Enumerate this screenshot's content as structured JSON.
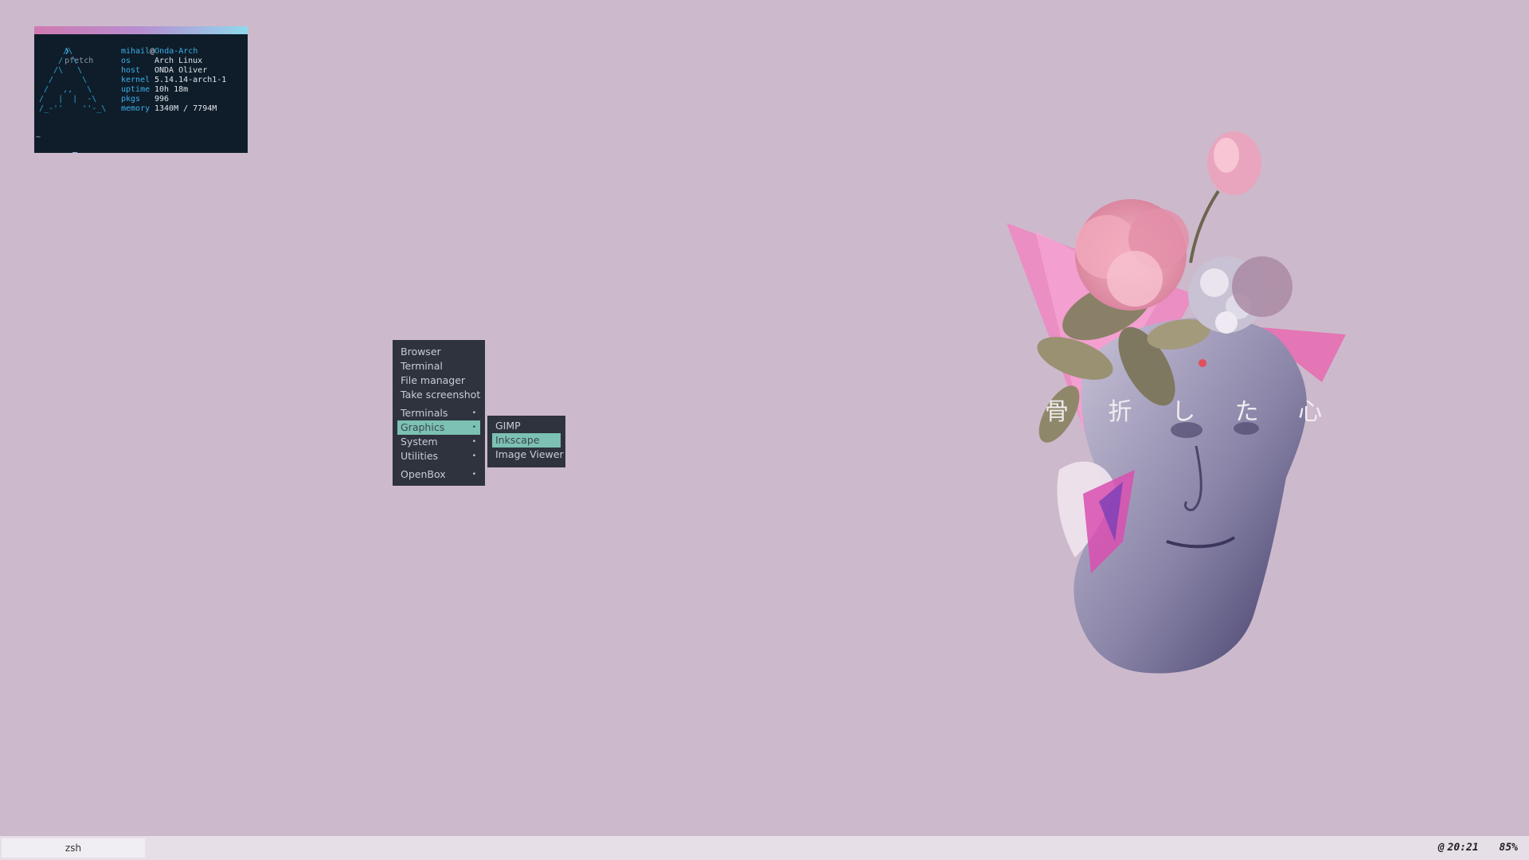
{
  "terminal": {
    "prompt_arrow": "❯",
    "command": "pfetch",
    "ascii_logo": "     /\\\n    /  \\\n   /\\   \\\n  /      \\\n /   ,,   \\\n/   |  |  -\\\n/_-''    ''-_\\",
    "user": "mihail",
    "at": "@",
    "host": "Onda-Arch",
    "info": [
      {
        "key": "os",
        "value": "Arch Linux"
      },
      {
        "key": "host",
        "value": "ONDA Oliver"
      },
      {
        "key": "kernel",
        "value": "5.14.14-arch1-1"
      },
      {
        "key": "uptime",
        "value": "10h 18m"
      },
      {
        "key": "pkgs",
        "value": "996"
      },
      {
        "key": "memory",
        "value": "1340M / 7794M"
      }
    ],
    "tilde": "~",
    "second_prompt": "❯"
  },
  "wallpaper": {
    "text": "骨 折 し た 心"
  },
  "menu": {
    "items": [
      {
        "label": "Browser",
        "submenu": false
      },
      {
        "label": "Terminal",
        "submenu": false
      },
      {
        "label": "File manager",
        "submenu": false
      },
      {
        "label": "Take screenshot",
        "submenu": false
      },
      {
        "label": "Terminals",
        "submenu": true
      },
      {
        "label": "Graphics",
        "submenu": true,
        "active": true
      },
      {
        "label": "System",
        "submenu": true
      },
      {
        "label": "Utilities",
        "submenu": true
      },
      {
        "label": "OpenBox",
        "submenu": true
      }
    ],
    "arrow": "•"
  },
  "submenu": {
    "items": [
      {
        "label": "GIMP"
      },
      {
        "label": "Inkscape",
        "active": true
      },
      {
        "label": "Image Viewer"
      }
    ]
  },
  "taskbar": {
    "task_label": "zsh",
    "clock_icon": "@",
    "time": "20:21",
    "battery": "85%"
  },
  "colors": {
    "desktop_bg": "#cdb9cc",
    "terminal_bg": "#0f1d2a",
    "menu_bg": "#2e333d",
    "menu_highlight": "#7cc1b2",
    "taskbar_bg": "#e6dfe8"
  }
}
